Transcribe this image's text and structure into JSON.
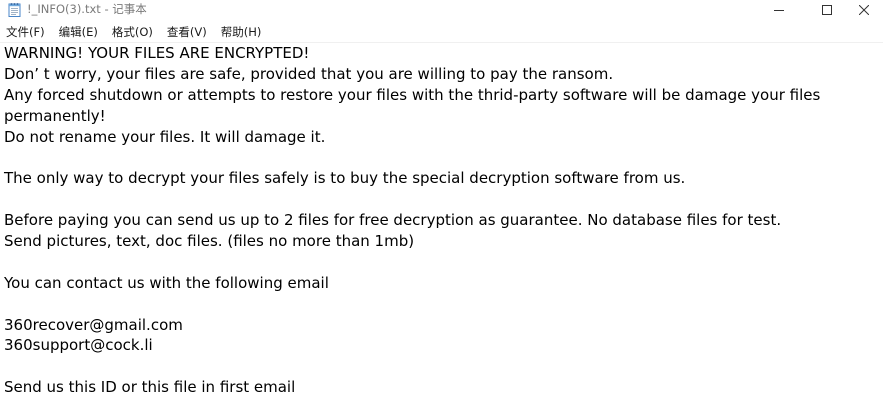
{
  "window": {
    "title": "!_INFO(3).txt - 记事本",
    "icon": "notepad-icon"
  },
  "menu": [
    {
      "label": "文件(F)"
    },
    {
      "label": "编辑(E)"
    },
    {
      "label": "格式(O)"
    },
    {
      "label": "查看(V)"
    },
    {
      "label": "帮助(H)"
    }
  ],
  "document": {
    "lines": [
      "WARNING! YOUR FILES ARE ENCRYPTED!",
      "Don’ t worry, your files are safe, provided that you are willing to pay the ransom.",
      "Any forced shutdown or attempts to restore your files with the thrid-party software will be damage your files",
      "permanently!",
      "Do not rename your files. It will damage it.",
      "",
      "The only way to decrypt your files safely is to buy the special decryption software from us.",
      "",
      "Before paying you can send us up to 2 files for free decryption as guarantee. No database files for test.",
      "Send pictures, text, doc files. (files no more than 1mb)",
      "",
      "You can contact us with the following email",
      "",
      "360recover@gmail.com",
      "360support@cock.li",
      "",
      "Send us this ID or this file in first email"
    ]
  }
}
